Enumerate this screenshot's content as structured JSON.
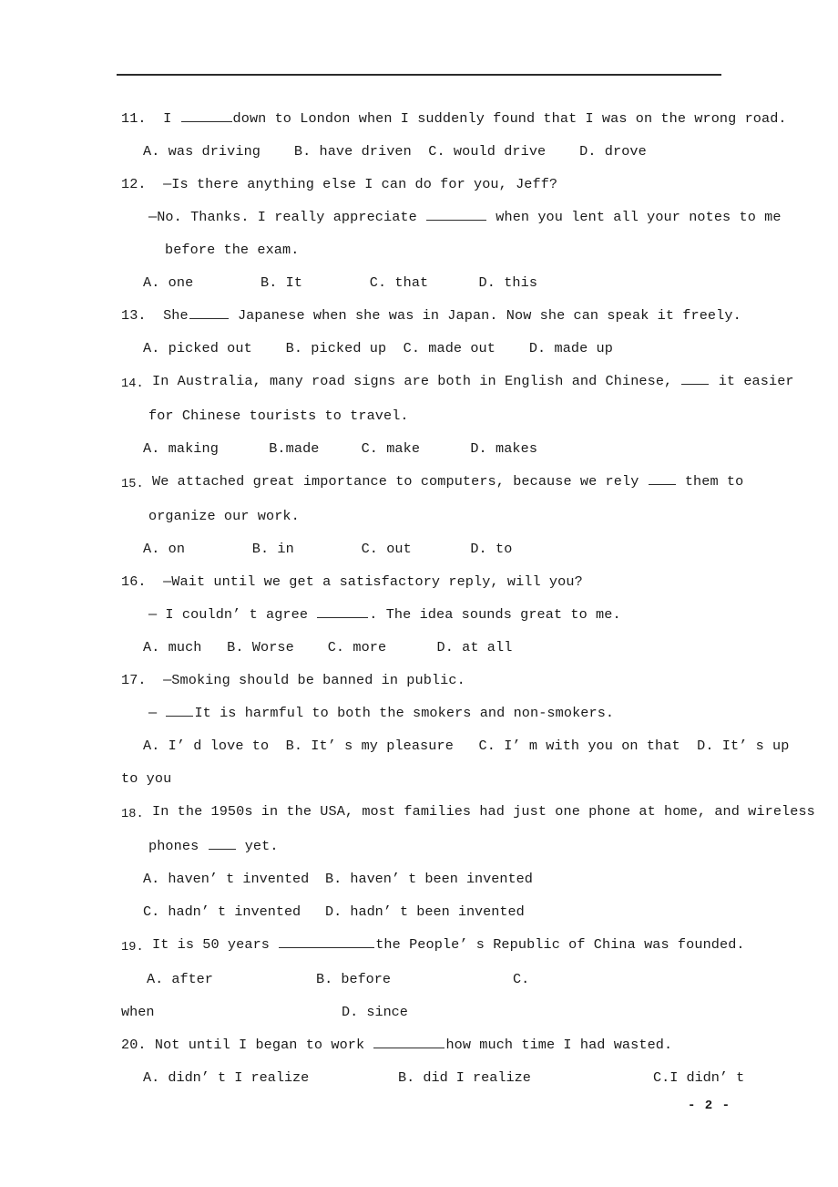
{
  "document": {
    "page_number": "- 2 -"
  },
  "questions": [
    {
      "number": "11.",
      "stem_before": "  I ",
      "stem_after": "down to London when I suddenly found that I was on the wrong road.",
      "options_line": "A. was driving    B. have driven  C. would drive    D. drove"
    },
    {
      "number": "12.",
      "stem_line": "  —Is there anything else I can do for you, Jeff?",
      "reply_before": "—No. Thanks. I really appreciate ",
      "reply_after": " when you lent all your notes to me",
      "continuation": "before the exam.",
      "options_line": "A. one        B. It        C. that      D. this"
    },
    {
      "number": "13.",
      "stem_before": "  She",
      "stem_after": " Japanese when she was in Japan. Now she can speak it freely.",
      "options_line": "A. picked out    B. picked up  C. made out    D. made up"
    },
    {
      "number": "14.",
      "stem_before": " In Australia, many road signs are both in English and Chinese, ",
      "stem_after": " it easier",
      "continuation": "for Chinese tourists to travel.",
      "options_line": "A. making      B.made     C. make      D. makes"
    },
    {
      "number": "15.",
      "stem_before": " We attached great importance to computers, because we rely ",
      "stem_after": " them to",
      "continuation": "organize our work.",
      "options_line": "A. on        B. in        C. out       D. to"
    },
    {
      "number": "16.",
      "stem_line": "  —Wait until we get a satisfactory reply, will you?",
      "reply_before": "— I couldn’ t agree ",
      "reply_after": ". The idea sounds great to me.",
      "options_line": "A. much   B. Worse    C. more      D. at all"
    },
    {
      "number": "17.",
      "stem_line": "  —Smoking should be banned in public.",
      "reply_before": "— ",
      "reply_after": "It is harmful to both the smokers and non-smokers.",
      "options_line": "A. I’ d love to  B. It’ s my pleasure   C. I’ m with you on that  D. It’ s up",
      "options_overflow": "to you"
    },
    {
      "number": "18.",
      "stem_line": " In the 1950s in the USA, most families had just one phone at home, and wireless",
      "continuation_before": "phones ",
      "continuation_after": " yet.",
      "option_a": "A. haven’ t invented",
      "option_b": "B. haven’ t been invented",
      "option_c": "C. hadn’ t invented",
      "option_d": "D. hadn’ t been invented"
    },
    {
      "number": "19.",
      "stem_before": " It is 50 years ",
      "stem_after": "the People’ s Republic of China was founded.",
      "option_a": "A. after",
      "option_b": "B. before",
      "option_c_label": "C.",
      "option_c_overflow": "when",
      "option_d": "D. since"
    },
    {
      "number": "20.",
      "stem_before": " Not until I began to work ",
      "stem_after": "how much time I had wasted.",
      "option_a": "A. didn’ t I realize",
      "option_b": "B. did I realize",
      "option_c": "C.I didn’ t"
    }
  ]
}
